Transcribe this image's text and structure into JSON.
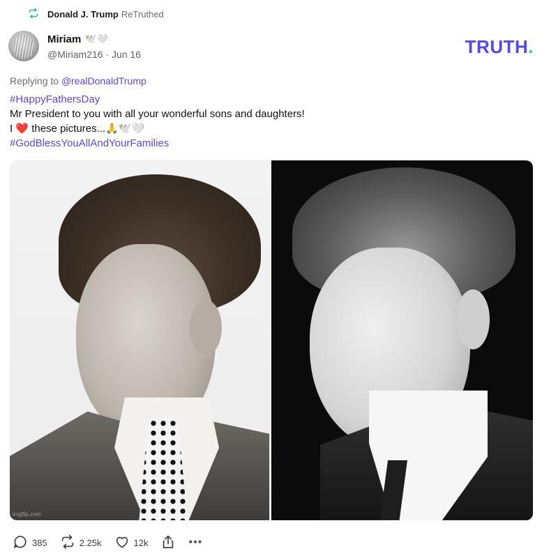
{
  "retruth": {
    "name": "Donald J. Trump",
    "label": "ReTruthed",
    "icon": "retruth-icon",
    "icon_color": "#17c38f"
  },
  "post": {
    "author_name": "Miriam",
    "author_emoji": "🕊️🤍",
    "author_handle": "@Miriam216",
    "separator": "·",
    "date": "Jun 16",
    "replying_prefix": "Replying to",
    "replying_to": "@realDonaldTrump",
    "hashtag_1": "#HappyFathersDay",
    "line_1": "Mr President to you with all your wonderful sons and daughters!",
    "line_2_start": "I",
    "line_2_heart": "❤️",
    "line_2_text": "these pictures...",
    "line_2_pray": "🙏",
    "line_2_dove": "🕊️🤍",
    "hashtag_2": "#GodBlessYouAllAndYourFamilies",
    "image_watermark": "imgflip.com"
  },
  "brand": {
    "logo_text": "TRUTH",
    "logo_dot": ".",
    "logo_color": "#5448ee",
    "dot_color": "#14d3b0"
  },
  "actions": {
    "replies": "385",
    "retruths": "2.25k",
    "likes": "12k",
    "more": "•••"
  },
  "colors": {
    "link": "#5448ee",
    "heart": "#d3162a"
  }
}
